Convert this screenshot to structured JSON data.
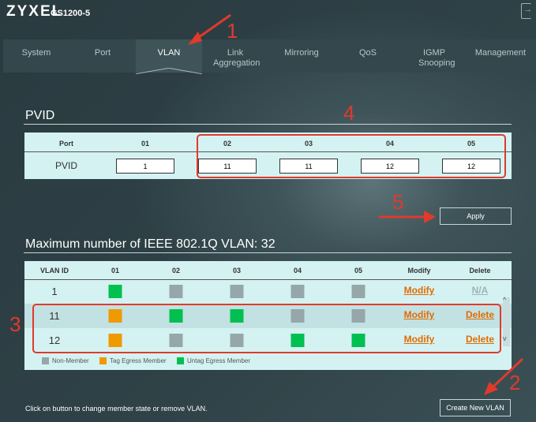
{
  "header": {
    "brand": "ZYXEL",
    "model": "GS1200-5",
    "logout_icon": "logout-icon"
  },
  "tabs": [
    {
      "label": "System"
    },
    {
      "label": "Port"
    },
    {
      "label": "VLAN",
      "active": true
    },
    {
      "label": "Link Aggregation"
    },
    {
      "label": "Mirroring"
    },
    {
      "label": "QoS"
    },
    {
      "label": "IGMP Snooping"
    },
    {
      "label": "Management"
    }
  ],
  "pvid": {
    "title": "PVID",
    "port_header": "Port",
    "row_label": "PVID",
    "ports": [
      "01",
      "02",
      "03",
      "04",
      "05"
    ],
    "values": [
      "1",
      "11",
      "11",
      "12",
      "12"
    ],
    "apply_label": "Apply"
  },
  "vlan": {
    "title": "Maximum number of IEEE 802.1Q VLAN: 32",
    "headers": [
      "VLAN ID",
      "01",
      "02",
      "03",
      "04",
      "05",
      "Modify",
      "Delete"
    ],
    "rows": [
      {
        "id": "1",
        "ports": [
          "untag",
          "non",
          "non",
          "non",
          "non"
        ],
        "modify": "Modify",
        "delete": "N/A"
      },
      {
        "id": "11",
        "ports": [
          "tag",
          "untag",
          "untag",
          "non",
          "non"
        ],
        "modify": "Modify",
        "delete": "Delete"
      },
      {
        "id": "12",
        "ports": [
          "tag",
          "non",
          "non",
          "untag",
          "untag"
        ],
        "modify": "Modify",
        "delete": "Delete"
      }
    ],
    "legend": [
      "Non-Member",
      "Tag Egress Member",
      "Untag Egress Member"
    ],
    "colors": {
      "non": "#95a7a9",
      "tag": "#ee9a00",
      "untag": "#00c050"
    }
  },
  "footer": {
    "hint": "Click on button to change member state or remove VLAN.",
    "create_label": "Create New VLAN"
  },
  "annotations": [
    "1",
    "2",
    "3",
    "4",
    "5"
  ]
}
